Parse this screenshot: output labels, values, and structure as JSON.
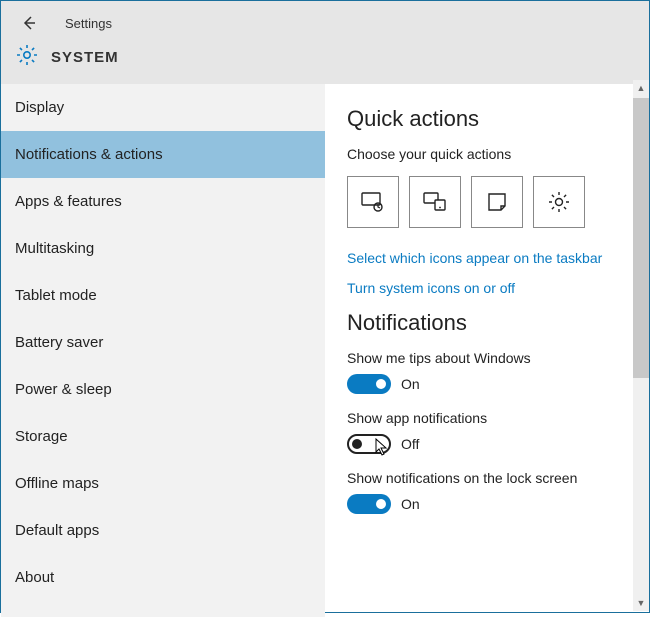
{
  "header": {
    "title": "Settings",
    "system_label": "SYSTEM"
  },
  "sidebar": {
    "items": [
      {
        "label": "Display"
      },
      {
        "label": "Notifications & actions"
      },
      {
        "label": "Apps & features"
      },
      {
        "label": "Multitasking"
      },
      {
        "label": "Tablet mode"
      },
      {
        "label": "Battery saver"
      },
      {
        "label": "Power & sleep"
      },
      {
        "label": "Storage"
      },
      {
        "label": "Offline maps"
      },
      {
        "label": "Default apps"
      },
      {
        "label": "About"
      }
    ],
    "selected_index": 1
  },
  "content": {
    "quick_actions": {
      "title": "Quick actions",
      "subtitle": "Choose your quick actions",
      "tiles": [
        "tablet-mode-icon",
        "connect-icon",
        "note-icon",
        "all-settings-icon"
      ],
      "link_taskbar": "Select which icons appear on the taskbar",
      "link_system_icons": "Turn system icons on or off"
    },
    "notifications": {
      "title": "Notifications",
      "tips": {
        "label": "Show me tips about Windows",
        "state": "On",
        "on": true
      },
      "app": {
        "label": "Show app notifications",
        "state": "Off",
        "on": false
      },
      "lock": {
        "label": "Show notifications on the lock screen",
        "state": "On",
        "on": true
      }
    }
  }
}
